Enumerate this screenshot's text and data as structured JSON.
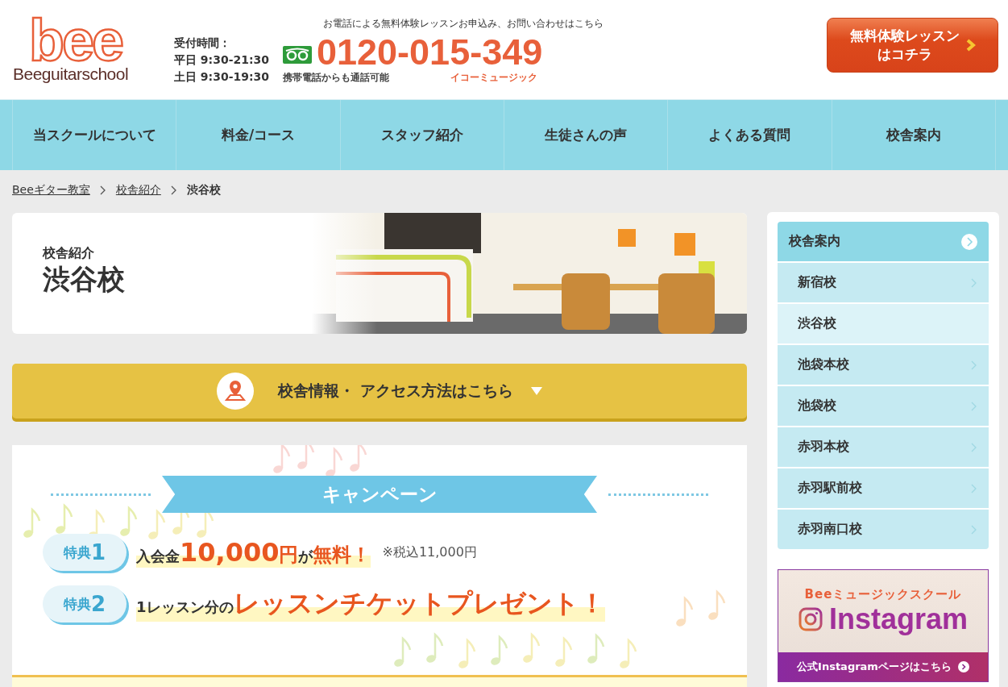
{
  "header": {
    "logo_mark": "bee",
    "logo_text": "Beeguitarschool",
    "tagline": "お電話による無料体験レッスンお申込み、お問い合わせはこちら",
    "hours": [
      "受付時間：",
      "平日 9:30-21:30",
      "土日 9:30-19:30"
    ],
    "phone": "0120-015-349",
    "phone_note": "携帯電話からも通話可能",
    "phone_name": "イコーミュージック",
    "cta": [
      "無料体験レッスン",
      "はコチラ"
    ]
  },
  "nav": [
    "当スクールについて",
    "料金/コース",
    "スタッフ紹介",
    "生徒さんの声",
    "よくある質問",
    "校舎案内"
  ],
  "breadcrumb": [
    {
      "label": "Beeギター教室",
      "link": true
    },
    {
      "label": "校舎紹介",
      "link": true
    },
    {
      "label": "渋谷校",
      "link": false
    }
  ],
  "hero": {
    "subtitle": "校舎紹介",
    "title": "渋谷校"
  },
  "access_button": "校舎情報・ アクセス方法はこちら",
  "campaign": {
    "title": "キャンペーン",
    "perks": [
      {
        "label": "特典",
        "number": "1",
        "parts": [
          {
            "kind": "plain",
            "text": "入会金"
          },
          {
            "kind": "big",
            "text": "10,000"
          },
          {
            "kind": "accent",
            "text": "円"
          },
          {
            "kind": "plain",
            "text": "が"
          },
          {
            "kind": "accent",
            "text": "無料！"
          }
        ],
        "note": "※税込11,000円"
      },
      {
        "label": "特典",
        "number": "2",
        "parts": [
          {
            "kind": "plain",
            "text": "1レッスン分の"
          },
          {
            "kind": "big",
            "text": "レッスンチケットプレゼント！"
          }
        ]
      }
    ]
  },
  "sidebar": {
    "heading": "校舎案内",
    "items": [
      {
        "label": "新宿校",
        "selected": false
      },
      {
        "label": "渋谷校",
        "selected": true
      },
      {
        "label": "池袋本校",
        "selected": false
      },
      {
        "label": "池袋校",
        "selected": false
      },
      {
        "label": "赤羽本校",
        "selected": false
      },
      {
        "label": "赤羽駅前校",
        "selected": false
      },
      {
        "label": "赤羽南口校",
        "selected": false
      }
    ]
  },
  "instagram": {
    "caption": "Beeミュージックスクール",
    "brand": "Instagram",
    "link": "公式Instagramページはこちら"
  }
}
